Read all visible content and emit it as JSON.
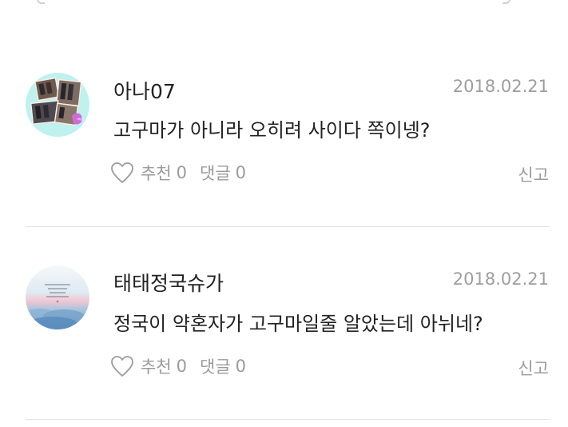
{
  "comments": [
    {
      "author": "아나07",
      "date": "2018.02.21",
      "text": "고구마가 아니라 오히려 사이다 쪽이넹?",
      "like_label": "추천",
      "like_count": "0",
      "reply_label": "댓글",
      "reply_count": "0",
      "report_label": "신고",
      "avatar_icon": "photo-collage-avatar-icon"
    },
    {
      "author": "태태정국슈가",
      "date": "2018.02.21",
      "text": "정국이 약혼자가 고구마일줄 알았는데  아뉘네?",
      "like_label": "추천",
      "like_count": "0",
      "reply_label": "댓글",
      "reply_count": "0",
      "report_label": "신고",
      "avatar_icon": "sky-clouds-avatar-icon"
    }
  ],
  "colors": {
    "text": "#222222",
    "muted": "#9b9b9b",
    "date": "#9e9e9e",
    "divider": "#e3e3e3"
  }
}
